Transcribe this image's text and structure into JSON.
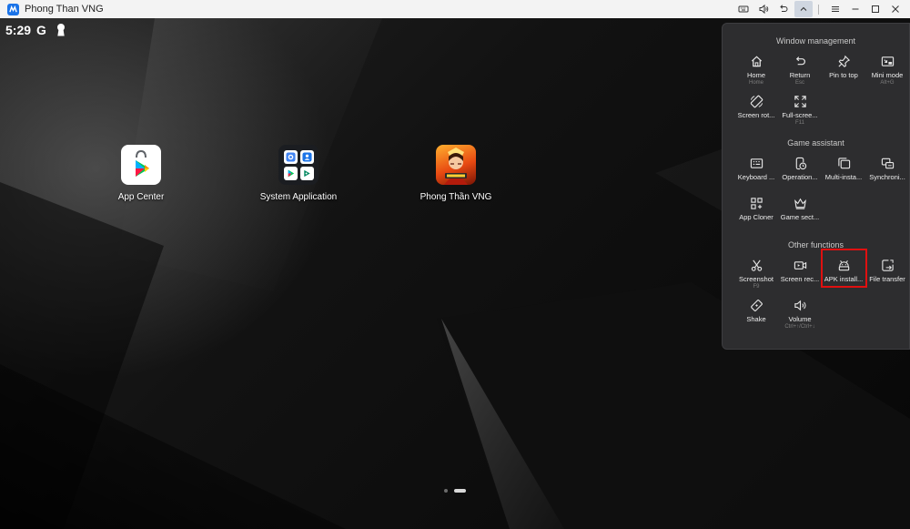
{
  "window": {
    "title": "Phong Than VNG",
    "controls": [
      "keyboard-icon",
      "volume-icon",
      "undo-icon",
      "chevron-up-icon",
      "menu-icon",
      "minimize-icon",
      "maximize-icon",
      "close-icon"
    ]
  },
  "statusbar": {
    "time": "5:29",
    "g": "G"
  },
  "desktop": {
    "apps": [
      {
        "label": "App Center"
      },
      {
        "label": "System Application"
      },
      {
        "label": "Phong Thần VNG"
      }
    ],
    "pager": {
      "pages": 2,
      "current": 2
    }
  },
  "panel": {
    "window_management": {
      "title": "Window management",
      "items": [
        {
          "label": "Home",
          "hint": "Home"
        },
        {
          "label": "Return",
          "hint": "Esc"
        },
        {
          "label": "Pin to top",
          "hint": ""
        },
        {
          "label": "Mini mode",
          "hint": "Alt+G"
        },
        {
          "label": "Screen rot...",
          "hint": ""
        },
        {
          "label": "Full-scree...",
          "hint": "F11"
        }
      ]
    },
    "game_assistant": {
      "title": "Game assistant",
      "items": [
        {
          "label": "Keyboard ...",
          "hint": ""
        },
        {
          "label": "Operation...",
          "hint": ""
        },
        {
          "label": "Multi-insta...",
          "hint": ""
        },
        {
          "label": "Synchroni...",
          "hint": ""
        },
        {
          "label": "App Cloner",
          "hint": ""
        },
        {
          "label": "Game sect...",
          "hint": ""
        }
      ]
    },
    "other_functions": {
      "title": "Other functions",
      "items": [
        {
          "label": "Screenshot",
          "hint": "F9"
        },
        {
          "label": "Screen rec...",
          "hint": ""
        },
        {
          "label": "APK install...",
          "hint": ""
        },
        {
          "label": "File transfer",
          "hint": ""
        },
        {
          "label": "Shake",
          "hint": ""
        },
        {
          "label": "Volume",
          "hint": "Ctrl+↑/Ctrl+↓"
        }
      ]
    },
    "highlight_color": "#e01010"
  }
}
